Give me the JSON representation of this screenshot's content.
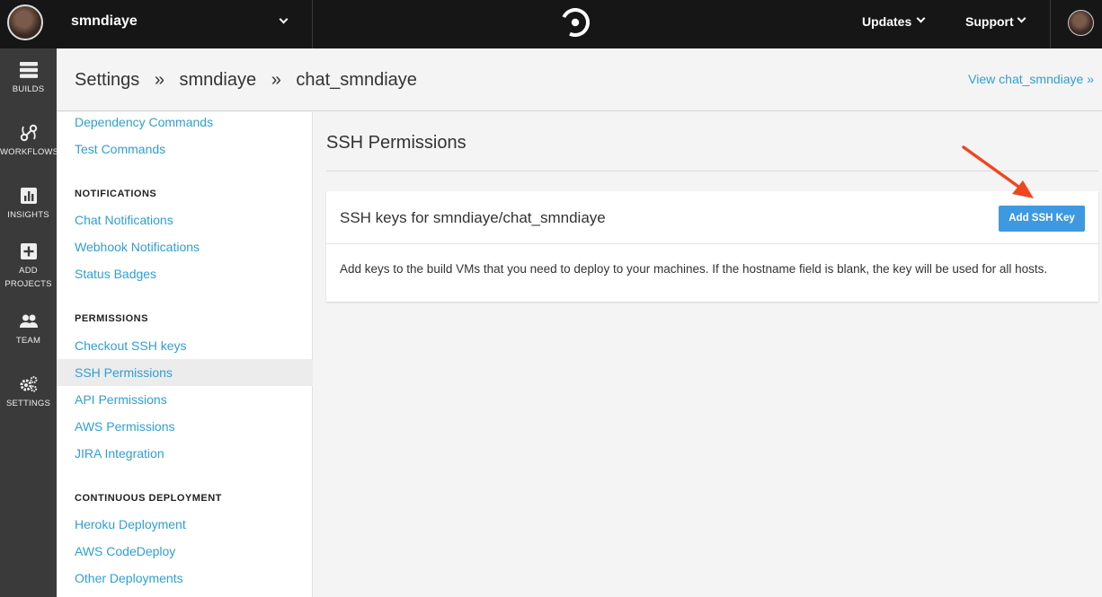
{
  "topbar": {
    "org_name": "smndiaye",
    "nav": {
      "updates": "Updates",
      "support": "Support"
    }
  },
  "leftnav": {
    "items": [
      {
        "label": "BUILDS",
        "icon": "builds-icon"
      },
      {
        "label": "WORKFLOWS",
        "icon": "workflows-icon"
      },
      {
        "label": "INSIGHTS",
        "icon": "insights-icon"
      },
      {
        "label_line1": "ADD",
        "label_line2": "PROJECTS",
        "icon": "add-projects-icon"
      },
      {
        "label": "TEAM",
        "icon": "team-icon"
      },
      {
        "label": "SETTINGS",
        "icon": "settings-icon"
      }
    ]
  },
  "header": {
    "crumbs": [
      "Settings",
      "»",
      "smndiaye",
      "»",
      "chat_smndiaye"
    ],
    "view_link": "View chat_smndiaye »"
  },
  "sidebar": {
    "top_links": [
      "Dependency Commands",
      "Test Commands"
    ],
    "notifications": {
      "heading": "NOTIFICATIONS",
      "links": [
        "Chat Notifications",
        "Webhook Notifications",
        "Status Badges"
      ]
    },
    "permissions": {
      "heading": "PERMISSIONS",
      "links": [
        "Checkout SSH keys",
        "SSH Permissions",
        "API Permissions",
        "AWS Permissions",
        "JIRA Integration"
      ],
      "active": "SSH Permissions"
    },
    "deployment": {
      "heading": "CONTINUOUS DEPLOYMENT",
      "links": [
        "Heroku Deployment",
        "AWS CodeDeploy",
        "Other Deployments"
      ]
    }
  },
  "main": {
    "title": "SSH Permissions",
    "card": {
      "title": "SSH keys for smndiaye/chat_smndiaye",
      "button": "Add SSH Key",
      "description": "Add keys to the build VMs that you need to deploy to your machines. If the hostname field is blank, the key will be used for all hosts."
    }
  },
  "colors": {
    "topbar": "#161616",
    "leftnav": "#3a3a3a",
    "link": "#2f9fd3",
    "button": "#3e99e0",
    "annotation_arrow": "#f0461f"
  }
}
